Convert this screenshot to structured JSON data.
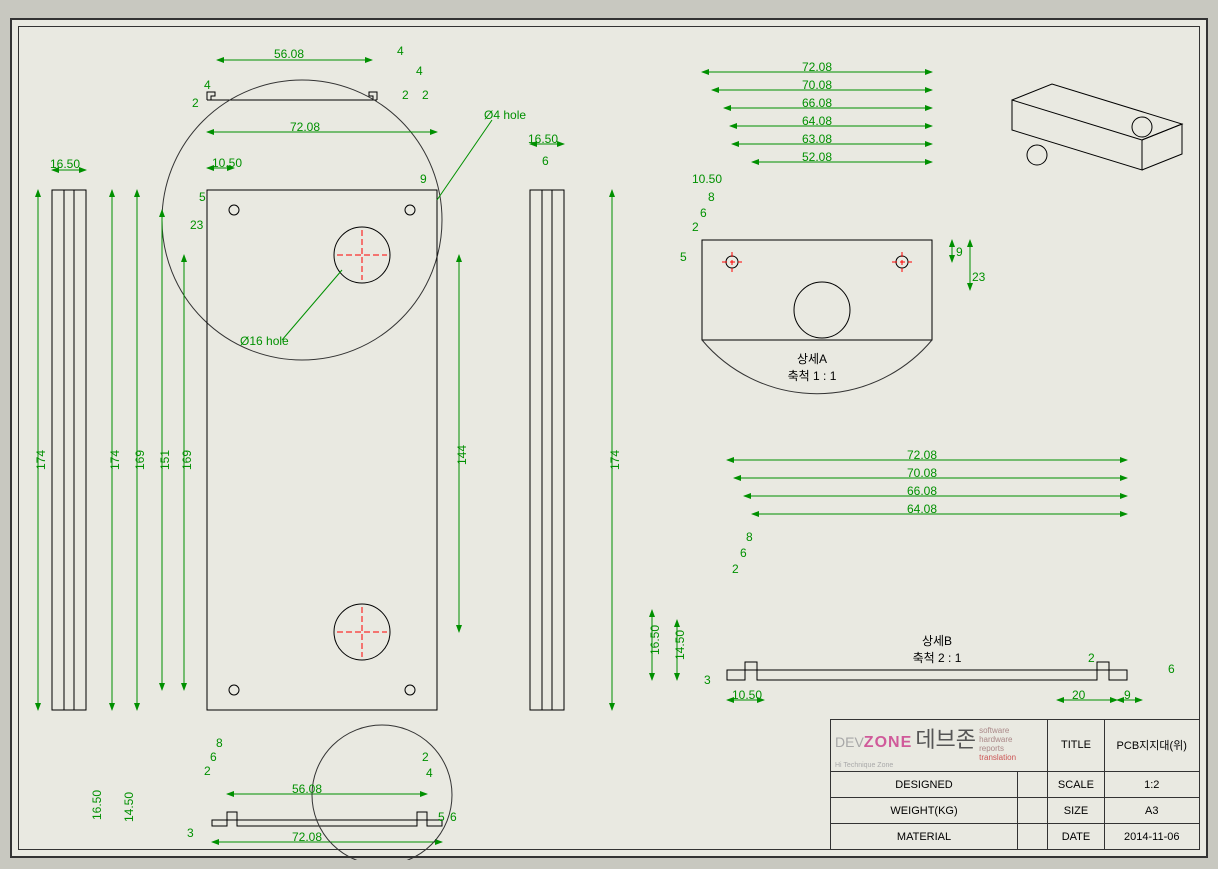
{
  "annotations": {
    "d4hole": "Ø4 hole",
    "d16hole": "Ø16 hole",
    "detA": "상세A",
    "detAsc": "축척 1 : 1",
    "detB": "상세B",
    "detBsc": "축척 2 : 1"
  },
  "dims": {
    "w56_08": "56.08",
    "w72_08": "72.08",
    "w70_08": "70.08",
    "w66_08": "66.08",
    "w64_08": "64.08",
    "w63_08": "63.08",
    "w52_08": "52.08",
    "n16_50": "16.50",
    "n14_50": "14.50",
    "n10_50": "10.50",
    "n174": "174",
    "n169": "169",
    "n151": "151",
    "n144": "144",
    "n23": "23",
    "n9": "9",
    "n8": "8",
    "n6": "6",
    "n5": "5",
    "n4": "4",
    "n3": "3",
    "n2": "2",
    "n20": "20"
  },
  "title_block": {
    "logo_dev": "DEV",
    "logo_zone": "ZONE",
    "logo_kr": "데브존",
    "logo_sub": "Hi Technique Zone",
    "tag1": "software",
    "tag2": "hardware",
    "tag3": "reports",
    "tag4": "translation",
    "row1_k": "TITLE",
    "row1_v": "PCB지지대(위)",
    "row2_k": "DESIGNED",
    "row2_v": "",
    "row3_k": "SCALE",
    "row3_v": "1:2",
    "row4_k": "WEIGHT(KG)",
    "row4_v": "",
    "row5_k": "SIZE",
    "row5_v": "A3",
    "row6_k": "MATERIAL",
    "row6_v": "",
    "row7_k": "DATE",
    "row7_v": "2014-11-06"
  }
}
